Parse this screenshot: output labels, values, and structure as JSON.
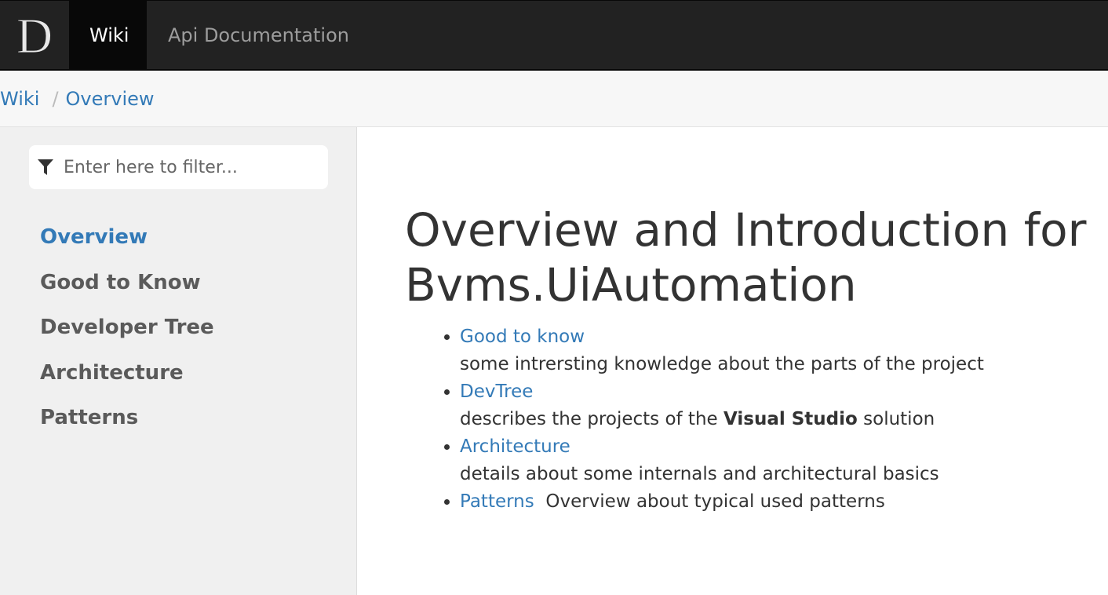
{
  "navbar": {
    "brand_letter": "D",
    "items": [
      {
        "label": "Wiki",
        "active": true
      },
      {
        "label": "Api Documentation",
        "active": false
      }
    ]
  },
  "breadcrumb": {
    "items": [
      "Wiki",
      "Overview"
    ],
    "separator": "/"
  },
  "sidebar": {
    "filter_placeholder": "Enter here to filter...",
    "items": [
      {
        "label": "Overview",
        "active": true
      },
      {
        "label": "Good to Know",
        "active": false
      },
      {
        "label": "Developer Tree",
        "active": false
      },
      {
        "label": "Architecture",
        "active": false
      },
      {
        "label": "Patterns",
        "active": false
      }
    ]
  },
  "main": {
    "title": "Overview and Introduction for Bvms.UiAutomation",
    "links": [
      {
        "label": "Good to know",
        "description": "some intrersting knowledge about the parts of the project"
      },
      {
        "label": "DevTree",
        "description_before": "describes the projects of the ",
        "description_bold": "Visual Studio",
        "description_after": " solution"
      },
      {
        "label": "Architecture",
        "description": "details about some internals and architectural basics"
      },
      {
        "label": "Patterns",
        "description": "Overview about typical used patterns"
      }
    ]
  },
  "colors": {
    "navbar_bg": "#222222",
    "link": "#337ab7",
    "sidebar_bg": "#f0f0f0"
  }
}
